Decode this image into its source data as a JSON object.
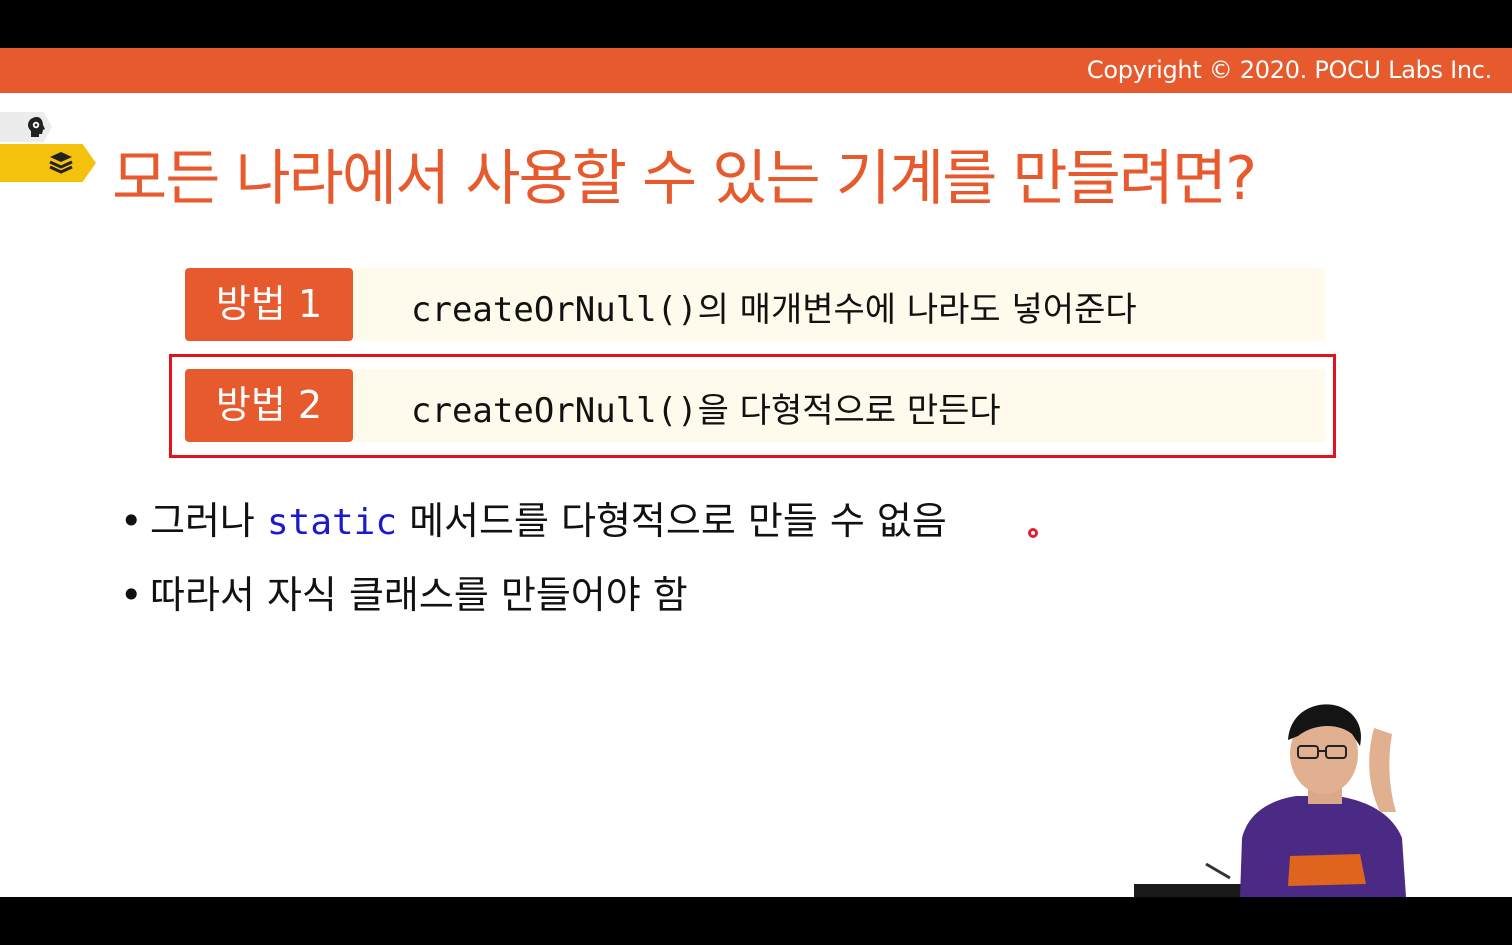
{
  "header": {
    "copyright": "Copyright © 2020. POCU Labs Inc."
  },
  "side_tabs": [
    {
      "icon": "head-gear-icon"
    },
    {
      "icon": "books-icon"
    }
  ],
  "title": "모든 나라에서 사용할 수 있는 기계를 만들려면?",
  "methods": [
    {
      "badge": "방법 1",
      "code": "createOrNull()",
      "text": "의 매개변수에 나라도 넣어준다",
      "highlighted": false
    },
    {
      "badge": "방법 2",
      "code": "createOrNull()",
      "text": "을 다형적으로 만든다",
      "highlighted": true
    }
  ],
  "bullets": [
    {
      "bullet": "•",
      "prefix": "그러나 ",
      "keyword": "static",
      "suffix": " 메서드를 다형적으로 만들 수 없음"
    },
    {
      "bullet": "•",
      "text": "따라서 자식 클래스를 만들어야 함"
    }
  ],
  "colors": {
    "accent": "#e65a2e",
    "highlight_border": "#e0141c",
    "method_bg": "#fefaec",
    "keyword": "#1b1bcc",
    "tab_yellow": "#f4c20d"
  }
}
